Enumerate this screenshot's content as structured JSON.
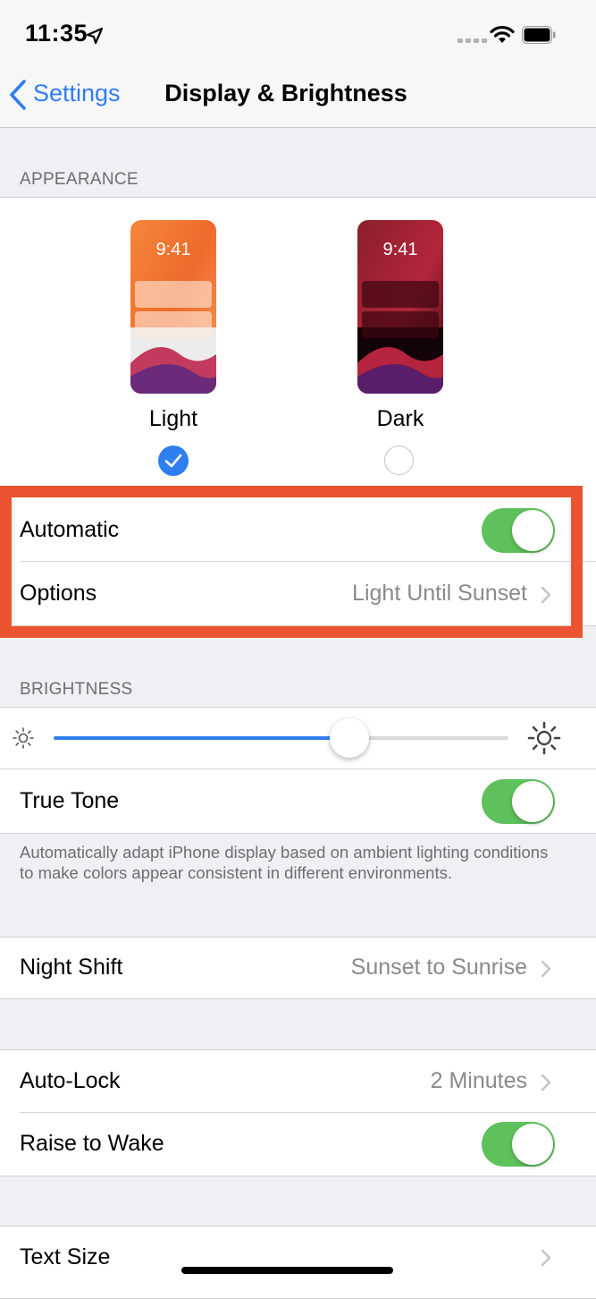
{
  "status_bar": {
    "time": "11:35"
  },
  "nav": {
    "back_label": "Settings",
    "title": "Display & Brightness"
  },
  "appearance": {
    "header": "APPEARANCE",
    "light": {
      "label": "Light",
      "preview_time": "9:41",
      "selected": true
    },
    "dark": {
      "label": "Dark",
      "preview_time": "9:41",
      "selected": false
    },
    "automatic": {
      "label": "Automatic",
      "on": true
    },
    "options": {
      "label": "Options",
      "value": "Light Until Sunset"
    }
  },
  "brightness": {
    "header": "BRIGHTNESS",
    "level": 0.65,
    "true_tone": {
      "label": "True Tone",
      "on": true
    },
    "footnote": "Automatically adapt iPhone display based on ambient lighting conditions to make colors appear consistent in different environments."
  },
  "night_shift": {
    "label": "Night Shift",
    "value": "Sunset to Sunrise"
  },
  "auto_lock": {
    "label": "Auto-Lock",
    "value": "2 Minutes"
  },
  "raise_to_wake": {
    "label": "Raise to Wake",
    "on": true
  },
  "text_size": {
    "label": "Text Size"
  },
  "colors": {
    "accent": "#2f7ef0",
    "toggle_on": "#5ec15c",
    "highlight": "#ea5430"
  }
}
